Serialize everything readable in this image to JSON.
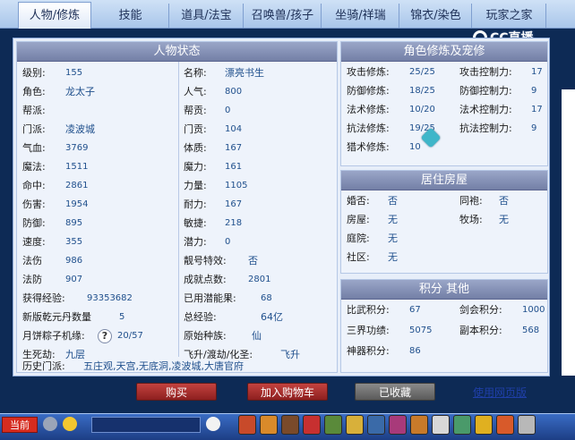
{
  "tabs": [
    "人物/修炼",
    "技能",
    "道具/法宝",
    "召唤兽/孩子",
    "坐骑/祥瑞",
    "锦衣/染色",
    "玩家之家"
  ],
  "logo_text": "CC直播",
  "char_status": {
    "title": "人物状态",
    "left_rows": [
      {
        "label": "级别:",
        "value": "155"
      },
      {
        "label": "角色:",
        "value": "龙太子"
      },
      {
        "label": "帮派:",
        "value": ""
      },
      {
        "label": "门派:",
        "value": "凌波城"
      },
      {
        "label": "气血:",
        "value": "3769"
      },
      {
        "label": "魔法:",
        "value": "1511"
      },
      {
        "label": "命中:",
        "value": "2861"
      },
      {
        "label": "伤害:",
        "value": "1954"
      },
      {
        "label": "防御:",
        "value": "895"
      },
      {
        "label": "速度:",
        "value": "355"
      },
      {
        "label": "法伤",
        "value": "986"
      },
      {
        "label": "法防",
        "value": "907"
      },
      {
        "label": "获得经验:",
        "value": "93353682"
      },
      {
        "label": "新版乾元丹数量",
        "value": "5"
      },
      {
        "label": "月饼粽子机缘:",
        "value": "20/57"
      },
      {
        "label": "生死劫:",
        "value": "九层"
      }
    ],
    "right_rows": [
      {
        "label": "名称:",
        "value": "漂亮书生"
      },
      {
        "label": "人气:",
        "value": "800"
      },
      {
        "label": "帮贡:",
        "value": "0"
      },
      {
        "label": "门贡:",
        "value": "104"
      },
      {
        "label": "体质:",
        "value": "167"
      },
      {
        "label": "魔力:",
        "value": "161"
      },
      {
        "label": "力量:",
        "value": "1105"
      },
      {
        "label": "耐力:",
        "value": "167"
      },
      {
        "label": "敏捷:",
        "value": "218"
      },
      {
        "label": "潜力:",
        "value": "0"
      },
      {
        "label": "靓号特效:",
        "value": "否"
      },
      {
        "label": "成就点数:",
        "value": "2801"
      },
      {
        "label": "已用潜能果:",
        "value": "68"
      },
      {
        "label": "总经验:",
        "value": "64亿"
      },
      {
        "label": "原始种族:",
        "value": "仙"
      },
      {
        "label": "飞升/渡劫/化圣:",
        "value": "飞升"
      }
    ],
    "history_label": "历史门派:",
    "history_value": "五庄观,天宫,无底洞,凌波城,大唐官府",
    "hint_icon": "?"
  },
  "cultivation": {
    "title": "角色修炼及宠修",
    "rows": [
      {
        "l_label": "攻击修炼:",
        "l_value": "25/25",
        "r_label": "攻击控制力:",
        "r_value": "17"
      },
      {
        "l_label": "防御修炼:",
        "l_value": "18/25",
        "r_label": "防御控制力:",
        "r_value": "9"
      },
      {
        "l_label": "法术修炼:",
        "l_value": "10/20",
        "r_label": "法术控制力:",
        "r_value": "17"
      },
      {
        "l_label": "抗法修炼:",
        "l_value": "19/25",
        "r_label": "抗法控制力:",
        "r_value": "9"
      },
      {
        "l_label": "猎术修炼:",
        "l_value": "10",
        "r_label": "",
        "r_value": ""
      }
    ]
  },
  "house": {
    "title": "居住房屋",
    "rows": [
      {
        "l_label": "婚否:",
        "l_value": "否",
        "r_label": "同袍:",
        "r_value": "否"
      },
      {
        "l_label": "房屋:",
        "l_value": "无",
        "r_label": "牧场:",
        "r_value": "无"
      },
      {
        "l_label": "庭院:",
        "l_value": "无",
        "r_label": "",
        "r_value": ""
      },
      {
        "l_label": "社区:",
        "l_value": "无",
        "r_label": "",
        "r_value": ""
      }
    ]
  },
  "points": {
    "title": "积分 其他",
    "rows": [
      {
        "l_label": "比武积分:",
        "l_value": "67",
        "r_label": "剑会积分:",
        "r_value": "1000"
      },
      {
        "l_label": "三界功绩:",
        "l_value": "5075",
        "r_label": "副本积分:",
        "r_value": "568"
      },
      {
        "l_label": "神器积分:",
        "l_value": "86",
        "r_label": "",
        "r_value": ""
      }
    ]
  },
  "buttons": {
    "buy": "购买",
    "add_cart": "加入购物车",
    "favorited": "已收藏",
    "web_version": "使用网页版"
  },
  "bottom_bar": {
    "current_channel": "当前"
  },
  "colors": {
    "section_header": "#8a96bb",
    "panel_bg": "#e7eef9",
    "value_text": "#1f4f8c",
    "button_red": "#a8302d",
    "button_gray": "#6e6e6e",
    "link": "#1f3fa8"
  }
}
